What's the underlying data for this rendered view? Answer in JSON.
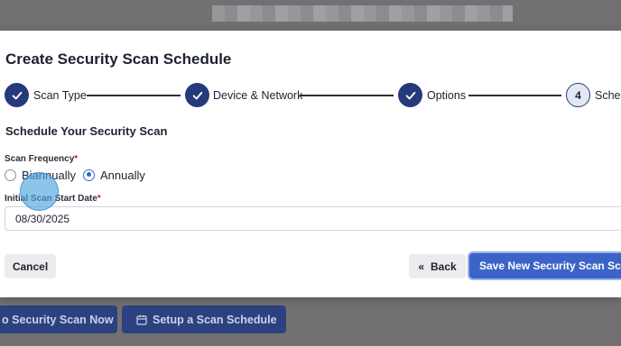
{
  "modal": {
    "title": "Create Security Scan Schedule",
    "steps": [
      {
        "label": "Scan Type",
        "status": "complete"
      },
      {
        "label": "Device & Network",
        "status": "complete"
      },
      {
        "label": "Options",
        "status": "complete"
      },
      {
        "number": "4",
        "label": "Sched",
        "status": "current"
      }
    ],
    "section_heading": "Schedule Your Security Scan",
    "frequency": {
      "label": "Scan Frequency",
      "required_mark": "*",
      "options": [
        "Biannually",
        "Annually"
      ],
      "selected": "Annually"
    },
    "start_date": {
      "label": "Initial Scan Start Date",
      "required_mark": "*",
      "value": "08/30/2025"
    },
    "buttons": {
      "cancel": "Cancel",
      "back": "Back",
      "back_icon": "«",
      "save": "Save New Security Scan Schedule"
    }
  },
  "background_buttons": {
    "scan_now": "o Security Scan Now",
    "setup_schedule": "Setup a Scan Schedule",
    "setup_icon": "calendar-icon"
  },
  "colors": {
    "primary": "#26397a",
    "accent": "#3c64c8",
    "required": "#b4232a"
  }
}
